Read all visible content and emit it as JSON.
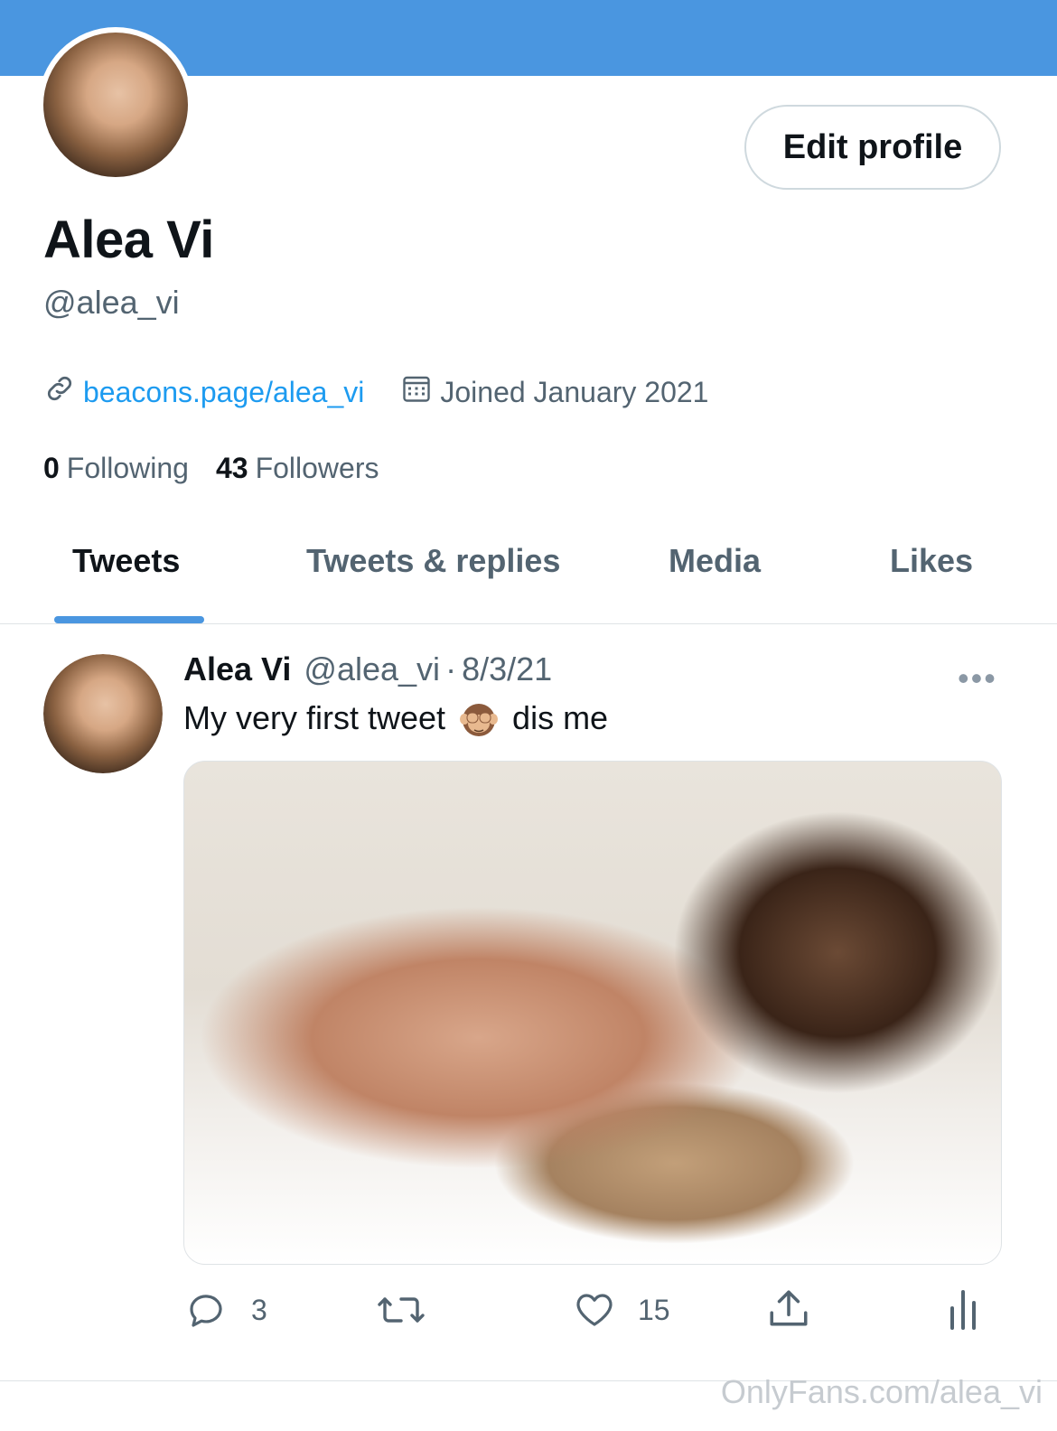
{
  "header": {
    "banner_color": "#4a96e0"
  },
  "profile": {
    "name": "Alea Vi",
    "handle": "@alea_vi",
    "edit_button": "Edit profile",
    "website": "beacons.page/alea_vi",
    "joined": "Joined January 2021",
    "following_count": "0",
    "following_label": "Following",
    "followers_count": "43",
    "followers_label": "Followers"
  },
  "tabs": [
    {
      "label": "Tweets",
      "active": true
    },
    {
      "label": "Tweets & replies",
      "active": false
    },
    {
      "label": "Media",
      "active": false
    },
    {
      "label": "Likes",
      "active": false
    }
  ],
  "tweet": {
    "author": "Alea Vi",
    "handle": "@alea_vi",
    "separator": "·",
    "date": "8/3/21",
    "text_before": "My very first tweet",
    "emoji": "see-no-evil-monkey-emoji",
    "text_after": "dis me",
    "replies": "3",
    "retweets": "",
    "likes": "15"
  },
  "icons": {
    "more": "more-icon",
    "link": "link-icon",
    "calendar": "calendar-icon",
    "reply": "reply-icon",
    "retweet": "retweet-icon",
    "like": "heart-icon",
    "share": "share-icon",
    "analytics": "analytics-icon"
  },
  "watermark": "OnlyFans.com/alea_vi",
  "colors": {
    "link": "#1d9bf0",
    "secondary_text": "#536471",
    "accent": "#4a96e0"
  }
}
